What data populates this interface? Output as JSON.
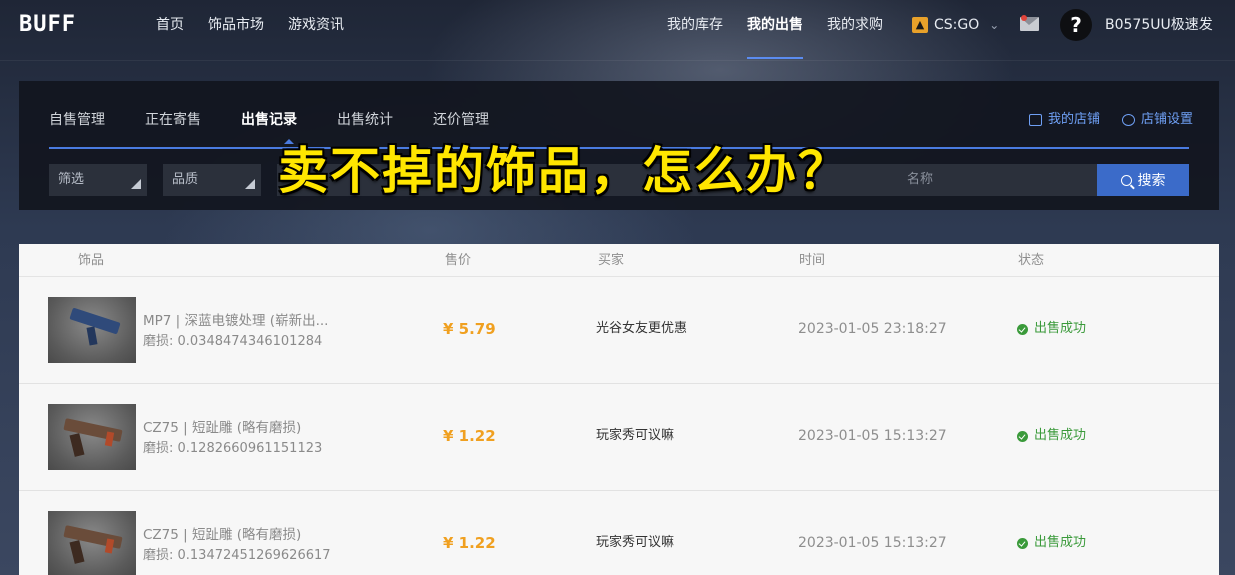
{
  "header": {
    "logo": "BUFF",
    "nav": [
      "首页",
      "饰品市场",
      "游戏资讯"
    ],
    "right_nav": [
      "我的库存",
      "我的出售",
      "我的求购"
    ],
    "active_nav": "我的出售",
    "game": "CS:GO",
    "username": "B0575UU极速发",
    "help_glyph": "?"
  },
  "subnav": {
    "tabs": [
      "自售管理",
      "正在寄售",
      "出售记录",
      "出售统计",
      "还价管理"
    ],
    "active_tab": "出售记录",
    "my_shop": "我的店铺",
    "shop_settings": "店铺设置"
  },
  "filters": {
    "filter_label": "筛选",
    "quality_label": "品质",
    "search_placeholder_visible": "名称",
    "search_button": "搜索"
  },
  "overlay_title": "卖不掉的饰品，怎么办？",
  "table": {
    "headers": [
      "饰品",
      "售价",
      "买家",
      "时间",
      "状态"
    ],
    "rows": [
      {
        "name": "MP7 | 深蓝电镀处理 (崭新出...",
        "wear": "磨损: 0.0348474346101284",
        "price": "¥ 5.79",
        "buyer": "光谷女友更优惠",
        "time": "2023-01-05 23:18:27",
        "status": "出售成功"
      },
      {
        "name": "CZ75 | 短趾雕 (略有磨损)",
        "wear": "磨损: 0.1282660961151123",
        "price": "¥ 1.22",
        "buyer": "玩家秀可议嘛",
        "time": "2023-01-05 15:13:27",
        "status": "出售成功"
      },
      {
        "name": "CZ75 | 短趾雕 (略有磨损)",
        "wear": "磨损: 0.13472451269626617",
        "price": "¥ 1.22",
        "buyer": "玩家秀可议嘛",
        "time": "2023-01-05 15:13:27",
        "status": "出售成功"
      }
    ]
  },
  "colors": {
    "accent": "#4a7be0",
    "price": "#f0a020",
    "success": "#3a9a3a",
    "overlay": "#ffe600"
  }
}
